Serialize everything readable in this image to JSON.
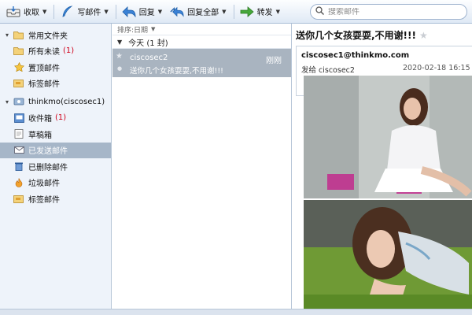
{
  "toolbar": {
    "receive": "收取",
    "compose": "写邮件",
    "reply": "回复",
    "reply_all": "回复全部",
    "forward": "转发",
    "search_placeholder": "搜索邮件"
  },
  "sidebar": {
    "local_group": "常用文件夹",
    "local_items": [
      {
        "label": "所有未读",
        "count": "(1)"
      },
      {
        "label": "置顶邮件",
        "count": ""
      },
      {
        "label": "标签邮件",
        "count": ""
      }
    ],
    "account_group": "thinkmo(ciscosec1)",
    "account_items": [
      {
        "label": "收件箱",
        "count": "(1)"
      },
      {
        "label": "草稿箱",
        "count": ""
      },
      {
        "label": "已发送邮件",
        "count": ""
      },
      {
        "label": "已删除邮件",
        "count": ""
      },
      {
        "label": "垃圾邮件",
        "count": ""
      },
      {
        "label": "标签邮件",
        "count": ""
      }
    ]
  },
  "list": {
    "sort_label": "排序:日期",
    "group_label": "今天 (1 封)",
    "messages": [
      {
        "from": "ciscosec2",
        "time": "刚刚",
        "subject": "送你几个女孩耍耍,不用谢!!!"
      }
    ]
  },
  "reader": {
    "title": "送你几个女孩耍耍,不用谢!!!",
    "sender": "ciscosec1@thinkmo.com",
    "to_line": "发给 ciscosec2",
    "date": "2020-02-18 16:15"
  },
  "colors": {
    "selected_folder": "#a6b6c8",
    "selected_message": "#a9b4c0",
    "unread_count": "#d0021b"
  }
}
